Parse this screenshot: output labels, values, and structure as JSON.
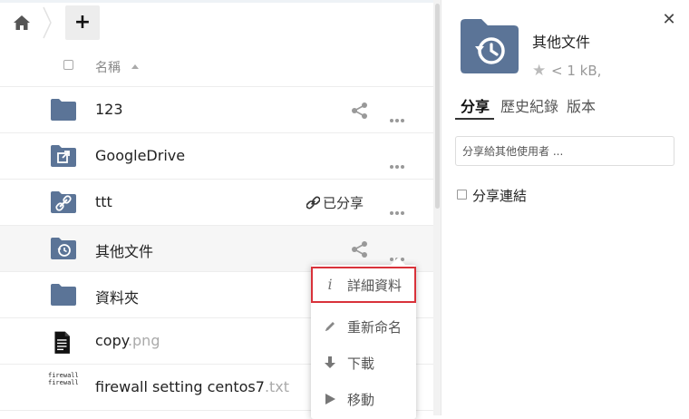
{
  "toolbar": {
    "home_icon": "home-icon",
    "add_label": "+"
  },
  "list": {
    "header_name": "名稱",
    "rows": [
      {
        "name": "123",
        "ext": "",
        "icon": "folder-icon",
        "share": "share-icon",
        "shared_label": ""
      },
      {
        "name": "GoogleDrive",
        "ext": "",
        "icon": "external-folder-icon",
        "share": "",
        "shared_label": ""
      },
      {
        "name": "ttt",
        "ext": "",
        "icon": "link-folder-icon",
        "share": "",
        "shared_label": "已分享"
      },
      {
        "name": "其他文件",
        "ext": "",
        "icon": "history-folder-icon",
        "share": "share-icon",
        "shared_label": ""
      },
      {
        "name": "資料夾",
        "ext": "",
        "icon": "folder-icon",
        "share": "",
        "shared_label": ""
      },
      {
        "name": "copy",
        "ext": ".png",
        "icon": "document-thumbnail-icon",
        "share": "",
        "shared_label": ""
      },
      {
        "name": "firewall setting centos7",
        "ext": ".txt",
        "icon": "text-thumbnail-icon",
        "share": "",
        "shared_label": ""
      }
    ],
    "text_thumb_lines": [
      "firewall-cmd",
      "firewall-cmd"
    ]
  },
  "context_menu": {
    "items": [
      {
        "label": "詳細資料",
        "icon": "info-icon"
      },
      {
        "label": "重新命名",
        "icon": "pencil-icon"
      },
      {
        "label": "下載",
        "icon": "download-icon"
      },
      {
        "label": "移動",
        "icon": "move-icon"
      }
    ]
  },
  "sidebar": {
    "title": "其他文件",
    "size": "< 1 kB,",
    "close_icon": "close-icon",
    "tabs": [
      {
        "label": "分享"
      },
      {
        "label": "歷史紀錄"
      },
      {
        "label": "版本"
      }
    ],
    "share_placeholder": "分享給其他使用者 ...",
    "share_link_label": "分享連結"
  },
  "colors": {
    "folder": "#5b7497",
    "highlight_border": "#d9323a"
  }
}
